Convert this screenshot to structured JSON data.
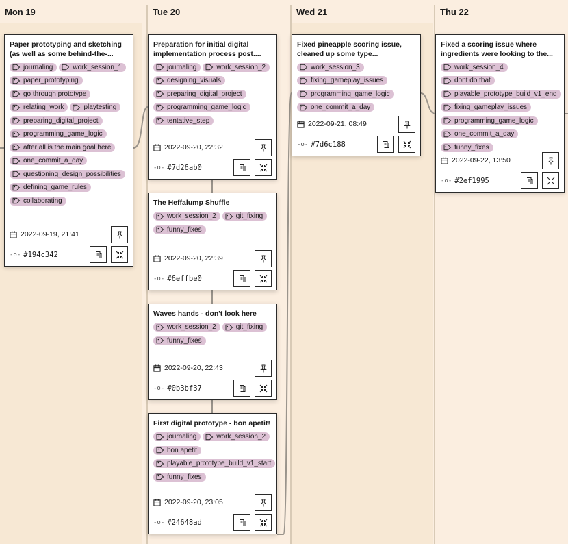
{
  "columns": [
    {
      "label": "Mon 19",
      "bg": "#f7e8d4"
    },
    {
      "label": "Tue 20",
      "bg": "#fbeee0"
    },
    {
      "label": "Wed 21",
      "bg": "#f7e8d4"
    },
    {
      "label": "Thu 22",
      "bg": "#fbeee0"
    }
  ],
  "cards": [
    {
      "title": "Paper prototyping and sketching (as well as some behind-the-...",
      "tags": [
        "journaling",
        "work_session_1",
        "paper_prototyping",
        "go through prototype",
        "relating_work",
        "playtesting",
        "preparing_digital_project",
        "programming_game_logic",
        "after all is the main goal here",
        "one_commit_a_day",
        "questioning_design_possibilities",
        "defining_game_rules",
        "collaborating"
      ],
      "date": "2022-09-19, 21:41",
      "hash": "#194c342"
    },
    {
      "title": "Preparation for initial digital implementation process post....",
      "tags": [
        "journaling",
        "work_session_2",
        "designing_visuals",
        "preparing_digital_project",
        "programming_game_logic",
        "tentative_step"
      ],
      "date": "2022-09-20, 22:32",
      "hash": "#7d26ab0"
    },
    {
      "title": "The Heffalump Shuffle",
      "tags": [
        "work_session_2",
        "git_fixing",
        "funny_fixes"
      ],
      "date": "2022-09-20, 22:39",
      "hash": "#6effbe0"
    },
    {
      "title": "Waves hands - don't look here",
      "tags": [
        "work_session_2",
        "git_fixing",
        "funny_fixes"
      ],
      "date": "2022-09-20, 22:43",
      "hash": "#0b3bf37"
    },
    {
      "title": "First digital prototype - bon apetit!",
      "tags": [
        "journaling",
        "work_session_2",
        "bon apetit",
        "playable_prototype_build_v1_start",
        "funny_fixes"
      ],
      "date": "2022-09-20, 23:05",
      "hash": "#24648ad"
    },
    {
      "title": "Fixed pineapple scoring issue, cleaned up some type...",
      "tags": [
        "work_session_3",
        "fixing_gameplay_issues",
        "programming_game_logic",
        "one_commit_a_day"
      ],
      "date": "2022-09-21, 08:49",
      "hash": "#7d6c188"
    },
    {
      "title": "Fixed a scoring issue where ingredients were looking to the...",
      "tags": [
        "work_session_4",
        "dont do that",
        "playable_prototype_build_v1_end",
        "fixing_gameplay_issues",
        "programming_game_logic",
        "one_commit_a_day",
        "funny_fixes"
      ],
      "date": "2022-09-22, 13:50",
      "hash": "#2ef1995"
    }
  ],
  "colors": {
    "tag": "#dcc1d4",
    "connector": "#9a948c",
    "border": "#2b2b2b"
  },
  "icons": {
    "tag": "tag-icon",
    "date": "calendar-icon",
    "commit": "commit-icon",
    "pin": "pin-icon",
    "doc": "document-icon",
    "collapse": "collapse-icon"
  }
}
